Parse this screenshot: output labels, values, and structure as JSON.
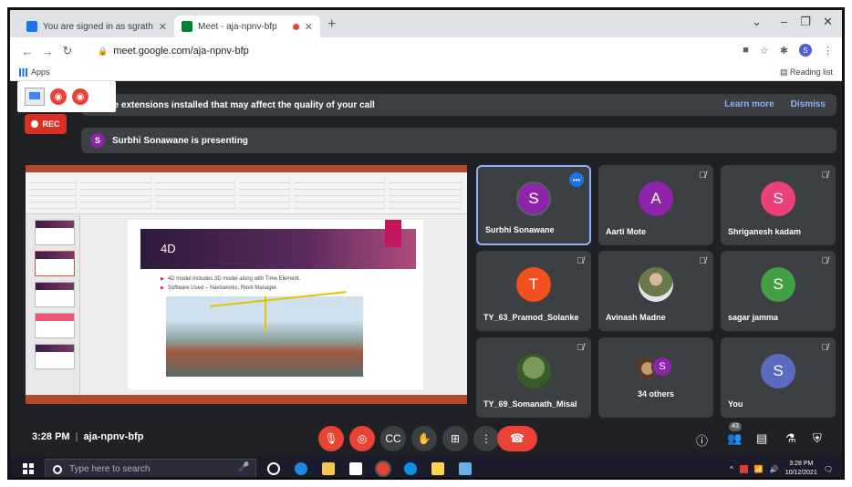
{
  "browser": {
    "tabs": [
      {
        "title": "You are signed in as sgrathodcivil",
        "favicon_color": "#1a73e8"
      },
      {
        "title": "Meet - aja-npnv-bfp",
        "favicon_color": "#00832d"
      }
    ],
    "new_tab": "+",
    "url": "meet.google.com/aja-npnv-bfp",
    "profile_initial": "S",
    "bookmarks": {
      "apps": "Apps",
      "reading_list": "Reading list"
    }
  },
  "meet": {
    "extension_banner": "ve extensions installed that may affect the quality of your call",
    "banner_links": {
      "learn_more": "Learn more",
      "dismiss": "Dismiss"
    },
    "rec_label": "REC",
    "presenting": {
      "initial": "S",
      "text": "Surbhi Sonawane is presenting"
    },
    "slide": {
      "title": "4D",
      "bullets": [
        "4D model includes 3D model along with Time Element.",
        "Software Used – Navisworks, Revit Manager."
      ]
    },
    "participants": [
      {
        "name": "Surbhi Sonawane",
        "initial": "S",
        "color": "#8e24aa",
        "active": true
      },
      {
        "name": "Aarti Mote",
        "initial": "A",
        "color": "#8e24aa"
      },
      {
        "name": "Shriganesh kadam",
        "initial": "S",
        "color": "#ec407a"
      },
      {
        "name": "TY_63_Pramod_Solanke",
        "initial": "T",
        "color": "#f4511e"
      },
      {
        "name": "Avinash Madne",
        "initial": "",
        "color": "photo"
      },
      {
        "name": "sagar jamma",
        "initial": "S",
        "color": "#43a047"
      },
      {
        "name": "TY_69_Somanath_Misal",
        "initial": "",
        "color": "photo"
      },
      {
        "name": "34 others",
        "initial": "S",
        "color": "#8e24aa"
      },
      {
        "name": "You",
        "initial": "S",
        "color": "#5c6bc0"
      }
    ],
    "bottom": {
      "time": "3:28 PM",
      "code": "aja-npnv-bfp",
      "people_count": "43"
    }
  },
  "taskbar": {
    "search_placeholder": "Type here to search",
    "time": "3:28 PM",
    "date": "10/12/2021"
  }
}
